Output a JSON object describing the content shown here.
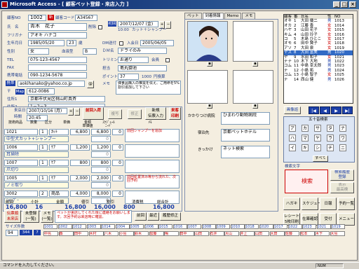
{
  "window": {
    "title": "Microsoft Access - [ 顧客ペット登録・来店入力 ]",
    "min": "_",
    "max": "□",
    "close": "×"
  },
  "customer": {
    "id_label": "顧客NO",
    "id": "1002",
    "new_tag": "新",
    "code_label": "顧客コード",
    "code": "A34567",
    "name_label": "氏　名",
    "name": "青木　花子",
    "deleted_label": "削除",
    "furigana_label": "フリガナ",
    "furigana": "アオキ ハナコ",
    "birth_label": "生年月日",
    "birth": "1985/05/20",
    "age": "23",
    "age_unit": "歳",
    "gender_label": "性別",
    "gender": "女",
    "blood_label": "血液型",
    "blood": "B",
    "tel_label": "TEL",
    "tel": "075-123-4567",
    "fax_label": "FAX",
    "mobile_label": "携帯電話",
    "mobile": "090-1234-5678",
    "mail_label": "携帯",
    "mail": "aokihanako@yahoo.co.jp",
    "mail_btn": "@",
    "zip_label": "〒",
    "map_btn": "Map",
    "zip": "612-0086",
    "addr1_label": "住所1",
    "addr1": "京都市伏見区桃山町真斉",
    "addr2_label": "住所2",
    "addr2": "1－2－3"
  },
  "visit_info": {
    "first_label": "初回",
    "first_date": "2007/12/07 (金)",
    "first_time": "10:00",
    "first_note": "カット＋シャンプー",
    "dm_label": "DM送付",
    "dm_checked": true,
    "mail_ok_label": "ﾒｰﾙ送付",
    "mail_ok": true,
    "member_label": "会員",
    "member": true,
    "join_label": "入会日",
    "join": "2005/06/05",
    "dm_name_label": "ＤＭ名",
    "dm_name": "ドライのみ",
    "trim_label": "トリミング",
    "trim": "お通り",
    "cut_label": "カット",
    "cut": "普通",
    "staff_label": "担当",
    "staff": "島丸御池",
    "point_label": "ポイント",
    "point": "37",
    "point_max": "1000",
    "point_unit": "円換算",
    "memo_label": "メモ",
    "memo": "弾食品購入の推奨を伝え、ご用命を5%割引追加して下さい"
  },
  "visit": {
    "section_label": "来店日",
    "date": "2007/10/16 (月)",
    "time": "20:45",
    "time_label": "時間",
    "prev_btn": "前回入荷",
    "copy_btn": "複写",
    "mod_btn": "修正",
    "new_btn": "新規\n伝票入力",
    "print_btn": "来客印刷",
    "headers": [
      "技術商品",
      "数量",
      "区分",
      "単価",
      "金額\n単価値",
      "ｽｹｼﾞｭｰﾙ\nﾆｰﾄﾞ",
      "ﾒﾓ"
    ],
    "rows": [
      {
        "code": "1021",
        "name": "中型犬カット+シャンプー",
        "qty": "1",
        "kbn": "ｶｯﾄ",
        "price": "6,800",
        "amount": "6,800",
        "disc": "0",
        "sched": "0",
        "memo": "前回シャンプーを追加"
      },
      {
        "code": "1006",
        "name": "耳掃除",
        "qty": "1",
        "kbn": "ｹｱ",
        "price": "1,200",
        "amount": "1,200",
        "disc": "0",
        "sched": "0",
        "memo": ""
      },
      {
        "code": "1007",
        "name": "爪切り",
        "qty": "1",
        "kbn": "ｹｱ",
        "price": "800",
        "amount": "800",
        "disc": "0",
        "sched": "0",
        "memo": ""
      },
      {
        "code": "1005",
        "name": "ノミ取り",
        "qty": "1",
        "kbn": "ｹｱ",
        "price": "2,000",
        "amount": "2,000",
        "disc": "0",
        "sched": "0",
        "memo": "前回処置済み等から流れた、次回予約"
      },
      {
        "code": "3002",
        "name": "ｼｬﾝﾌﾟｰ",
        "qty": "2",
        "kbn": "商品",
        "price": "4,000",
        "amount": "8,000",
        "disc": "0",
        "sched": "0",
        "memo": ""
      }
    ],
    "summary_labels": [
      "前回",
      "小計",
      "金額",
      "値引",
      "割引",
      "消費税",
      "総合計"
    ],
    "summary_values": [
      "16,800",
      "16",
      "16,800",
      "16,000",
      "800",
      "16,800"
    ],
    "buttons": {
      "unregistered": "伝票順\n未来店",
      "detail": "未登録\n(一覧)",
      "memo": "メモ\n(一覧)",
      "prev": "前回",
      "latest": "最近",
      "history": "履歴修正"
    },
    "memo_note": "ペットが来店してくれた後に連絡をお願いします。次回予約は来店時に確認。"
  },
  "pet": {
    "tabs": [
      "ペット",
      "到着情報",
      "Memo",
      "メモ"
    ],
    "hospital_label": "かかりつけ病院",
    "hospital": "ひまわり動物病院",
    "hotel_label": "宿泊先",
    "hotel": "京都ペットホテル",
    "trigger_label": "きっかけ",
    "trigger": "ネット検索"
  },
  "customer_list": {
    "headers": [
      "顧客",
      "番",
      "氏名",
      "性",
      "NO"
    ],
    "rows": [
      [
        "オキ",
        "1",
        "大田 優二",
        "男",
        "1013"
      ],
      [
        "オカ",
        "2",
        "江藤 香",
        "女",
        "1014"
      ],
      [
        "ハヤ",
        "3",
        "山田 花子",
        "女",
        "1015"
      ],
      [
        "キム",
        "4",
        "山田 玲子",
        "女",
        "1016"
      ],
      [
        "コ",
        "5",
        "木島 ひとこ",
        "女",
        "1017"
      ],
      [
        "オモ",
        "6",
        "田中 賢子",
        "女",
        "1018"
      ],
      [
        "アソ",
        "7",
        "大田 泉",
        "女",
        "1019"
      ],
      [
        "ヤス",
        "8",
        "大田 富美",
        "男",
        "1020"
      ],
      [
        "ヤ",
        "9",
        "水田 和子",
        "女",
        "1021"
      ],
      [
        "ナナ",
        "10",
        "木下 大地",
        "男",
        "1022"
      ],
      [
        "コム",
        "11",
        "中島 幸太郎",
        "男",
        "1023"
      ],
      [
        "ナ",
        "12",
        "小島 拓",
        "男",
        "1024"
      ],
      [
        "コム",
        "13",
        "小島 智子",
        "女",
        "1025"
      ],
      [
        "ナ",
        "14",
        "西山 健",
        "男",
        "1026"
      ]
    ],
    "highlighted": 7
  },
  "navigation": {
    "mode": "画像巡",
    "first": "|◀",
    "prev": "◀",
    "next": "▶",
    "last": "▶|"
  },
  "kana_panel": {
    "title": "五十音検索",
    "rows": [
      [
        "ア",
        "カ",
        "サ",
        "タ",
        "ナ"
      ],
      [
        "ハ",
        "マ",
        "ヤ",
        "ラ",
        "ワ"
      ],
      [
        "イ",
        "キ",
        "シ",
        "チ",
        "ニ"
      ]
    ],
    "all_label": "すべて"
  },
  "search": {
    "label": "検索文字",
    "button": "検索",
    "btn_new": "検索履歴\n登録",
    "btn_show": "表示\n最高検"
  },
  "side_buttons": [
    "ハガキ",
    "スケジュール",
    "日報",
    "予約一覧",
    "レシート\n5枚印刷",
    "在庫確認",
    "受付",
    "メニュー"
  ],
  "footer": {
    "count_label": "サイズ件数",
    "count": "94",
    "age_btn": "344",
    "gender_btn": "7",
    "codes": [
      "1001",
      "1002",
      "1012",
      "1003",
      "1014",
      "1004",
      "1005",
      "1006",
      "1015",
      "1016",
      "1007",
      "1008",
      "1009",
      "1010",
      "1018",
      "1020",
      "1017",
      "1022",
      "1023",
      "1021",
      "1019"
    ],
    "names": [
      "中島",
      "森",
      "田中",
      "木村",
      "八木",
      "小島",
      "鈴木",
      "加藤",
      "鳴",
      "田中",
      "山田",
      "石井",
      "大山",
      "井上",
      "山田",
      "大田",
      "佐藤",
      "松本",
      "木下",
      "大島"
    ]
  },
  "status": {
    "text": "コマンドを入力してください。",
    "num": "NUM"
  }
}
